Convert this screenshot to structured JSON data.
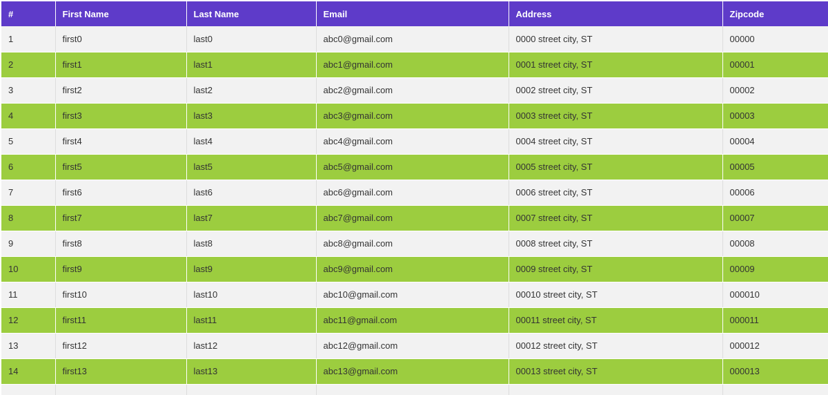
{
  "table": {
    "columns": [
      "#",
      "First Name",
      "Last Name",
      "Email",
      "Address",
      "Zipcode"
    ],
    "rows": [
      [
        "1",
        "first0",
        "last0",
        "abc0@gmail.com",
        "0000 street city, ST",
        "00000"
      ],
      [
        "2",
        "first1",
        "last1",
        "abc1@gmail.com",
        "0001 street city, ST",
        "00001"
      ],
      [
        "3",
        "first2",
        "last2",
        "abc2@gmail.com",
        "0002 street city, ST",
        "00002"
      ],
      [
        "4",
        "first3",
        "last3",
        "abc3@gmail.com",
        "0003 street city, ST",
        "00003"
      ],
      [
        "5",
        "first4",
        "last4",
        "abc4@gmail.com",
        "0004 street city, ST",
        "00004"
      ],
      [
        "6",
        "first5",
        "last5",
        "abc5@gmail.com",
        "0005 street city, ST",
        "00005"
      ],
      [
        "7",
        "first6",
        "last6",
        "abc6@gmail.com",
        "0006 street city, ST",
        "00006"
      ],
      [
        "8",
        "first7",
        "last7",
        "abc7@gmail.com",
        "0007 street city, ST",
        "00007"
      ],
      [
        "9",
        "first8",
        "last8",
        "abc8@gmail.com",
        "0008 street city, ST",
        "00008"
      ],
      [
        "10",
        "first9",
        "last9",
        "abc9@gmail.com",
        "0009 street city, ST",
        "00009"
      ],
      [
        "11",
        "first10",
        "last10",
        "abc10@gmail.com",
        "00010 street city, ST",
        "000010"
      ],
      [
        "12",
        "first11",
        "last11",
        "abc11@gmail.com",
        "00011 street city, ST",
        "000011"
      ],
      [
        "13",
        "first12",
        "last12",
        "abc12@gmail.com",
        "00012 street city, ST",
        "000012"
      ],
      [
        "14",
        "first13",
        "last13",
        "abc13@gmail.com",
        "00013 street city, ST",
        "000013"
      ]
    ]
  },
  "colors": {
    "header_bg": "#5e3bc9",
    "row_odd_bg": "#f2f2f2",
    "row_even_bg": "#9ccd3f"
  }
}
